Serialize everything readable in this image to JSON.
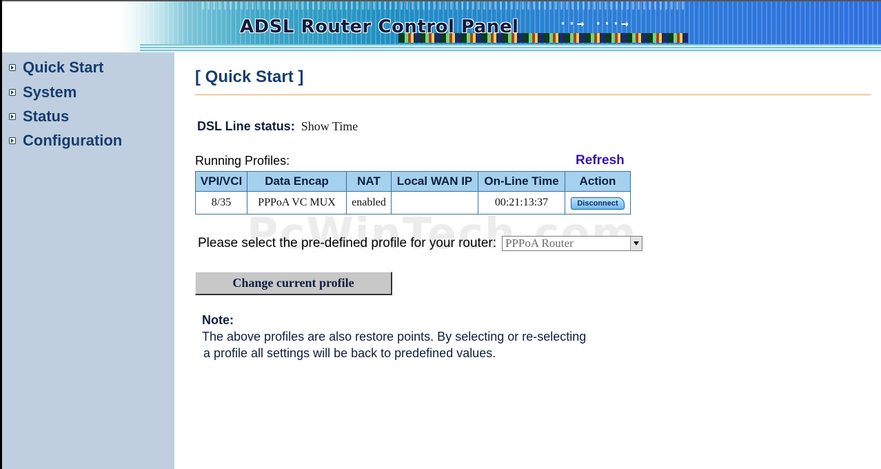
{
  "header": {
    "title": "ADSL Router Control Panel",
    "arrows": "··→ ···→"
  },
  "sidebar": {
    "items": [
      {
        "label": "Quick Start"
      },
      {
        "label": "System"
      },
      {
        "label": "Status"
      },
      {
        "label": "Configuration"
      }
    ]
  },
  "main": {
    "page_title": "[ Quick Start ]",
    "dsl_label": "DSL Line status:",
    "dsl_value": "Show Time",
    "running_profiles_label": "Running Profiles:",
    "refresh_label": "Refresh",
    "table": {
      "headers": [
        "VPI/VCI",
        "Data Encap",
        "NAT",
        "Local WAN IP",
        "On-Line Time",
        "Action"
      ],
      "rows": [
        {
          "vpi_vci": "8/35",
          "data_encap": "PPPoA  VC MUX",
          "nat": "enabled",
          "local_wan_ip": "",
          "online_time": "00:21:13:37",
          "action": "Disconnect"
        }
      ]
    },
    "select_label": "Please select the pre-defined profile for your router:",
    "select_value": "PPPoA Router",
    "change_button": "Change current profile",
    "note_title": "Note:",
    "note_line1": "The above profiles are also restore points. By selecting or re-selecting",
    "note_line2": "a profile all settings will be back to predefined values.",
    "watermark": "PcWinTech.com"
  },
  "colors": {
    "sidebar_bg": "#bfcfdf",
    "heading_text": "#173d6e",
    "table_header_bg": "#a5d0ee",
    "title_rule": "#e0a050",
    "refresh_link": "#3a14b0"
  }
}
